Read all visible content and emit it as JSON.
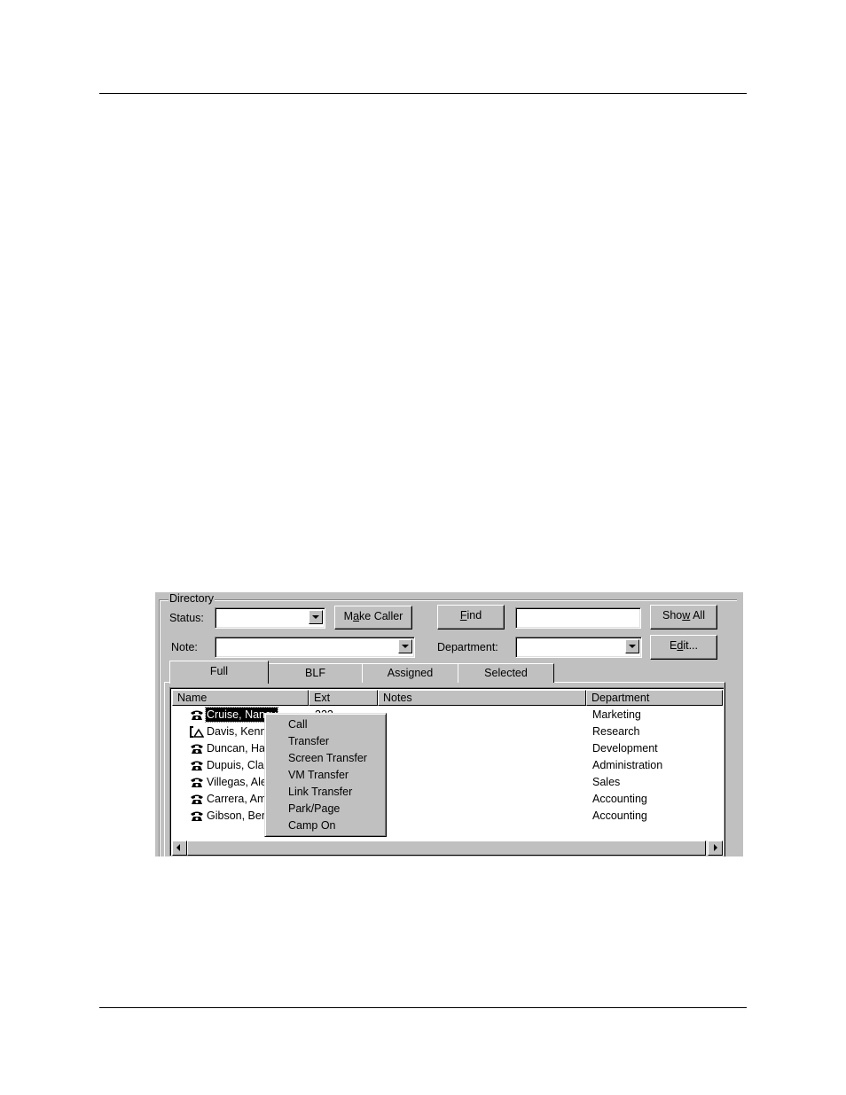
{
  "directory": {
    "group_title": "Directory",
    "status_label": "Status:",
    "status_value": "",
    "note_label": "Note:",
    "note_value": "",
    "department_label": "Department:",
    "department_value": "",
    "find_value": "",
    "buttons": {
      "make_caller": {
        "pre": "M",
        "accel": "a",
        "post": "ke Caller"
      },
      "find": {
        "pre": "",
        "accel": "F",
        "post": "ind"
      },
      "show_all": {
        "pre": "Sho",
        "accel": "w",
        "post": " All"
      },
      "edit": {
        "pre": "E",
        "accel": "d",
        "post": "it..."
      }
    },
    "tabs": [
      "Full",
      "BLF",
      "Assigned",
      "Selected"
    ],
    "active_tab": "Full",
    "columns": [
      "Name",
      "Ext",
      "Notes",
      "Department"
    ],
    "rows": [
      {
        "name": "Cruise, Nancy",
        "ext": "222",
        "notes": "",
        "department": "Marketing",
        "icon": "phone-icon",
        "selected": true
      },
      {
        "name": "Davis, Kenneth",
        "ext": "",
        "notes": "",
        "department": "Research",
        "icon": "phone-offhook-icon",
        "selected": false
      },
      {
        "name": "Duncan, Harold",
        "ext": "",
        "notes": "",
        "department": "Development",
        "icon": "phone-icon",
        "selected": false
      },
      {
        "name": "Dupuis, Claire",
        "ext": "",
        "notes": "",
        "department": "Administration",
        "icon": "phone-icon",
        "selected": false
      },
      {
        "name": "Villegas, Alex",
        "ext": "",
        "notes": "",
        "department": "Sales",
        "icon": "phone-icon",
        "selected": false
      },
      {
        "name": "Carrera, Amparo",
        "ext": "",
        "notes": "",
        "department": "Accounting",
        "icon": "phone-icon",
        "selected": false
      },
      {
        "name": "Gibson, Bernard",
        "ext": "",
        "notes": "",
        "department": "Accounting",
        "icon": "phone-icon",
        "selected": false
      }
    ]
  },
  "context_menu": {
    "items": [
      "Call",
      "Transfer",
      "Screen Transfer",
      "VM Transfer",
      "Link Transfer",
      "Park/Page",
      "Camp On"
    ]
  }
}
